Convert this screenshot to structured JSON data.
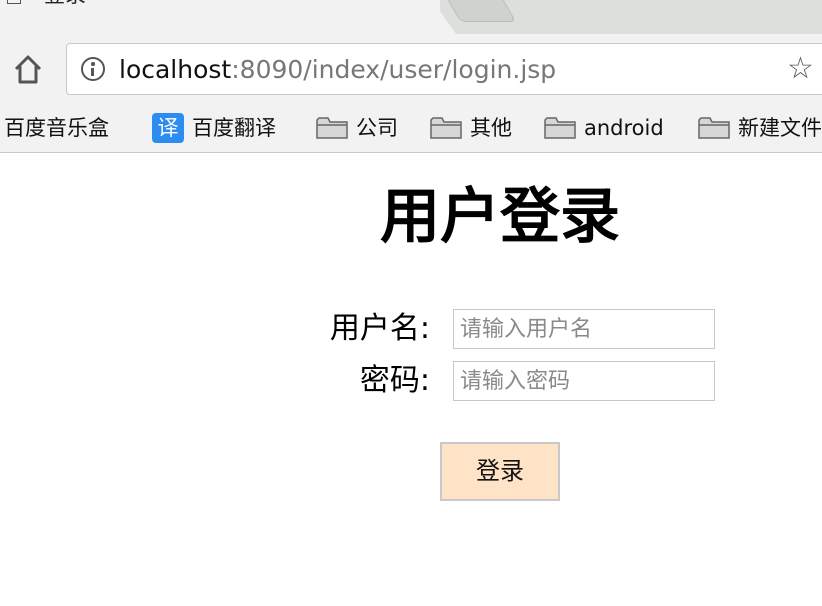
{
  "browser": {
    "tab": {
      "title": "登录",
      "close_glyph": "×"
    },
    "address_bar": {
      "host": "localhost",
      "rest": ":8090/index/user/login.jsp"
    },
    "bookmarks": [
      {
        "label": "百度音乐盒",
        "icon": "none"
      },
      {
        "label": "百度翻译",
        "icon": "translate-icon",
        "icon_text": "译"
      },
      {
        "label": "公司",
        "icon": "folder-icon"
      },
      {
        "label": "其他",
        "icon": "folder-icon"
      },
      {
        "label": "android",
        "icon": "folder-icon"
      },
      {
        "label": "新建文件",
        "icon": "folder-icon"
      }
    ]
  },
  "login": {
    "title": "用户登录",
    "username": {
      "label": "用户名:",
      "placeholder": "请输入用户名",
      "value": ""
    },
    "password": {
      "label": "密码:",
      "placeholder": "请输入密码",
      "value": ""
    },
    "submit_label": "登录",
    "submit_color": "#ffe3c6"
  }
}
